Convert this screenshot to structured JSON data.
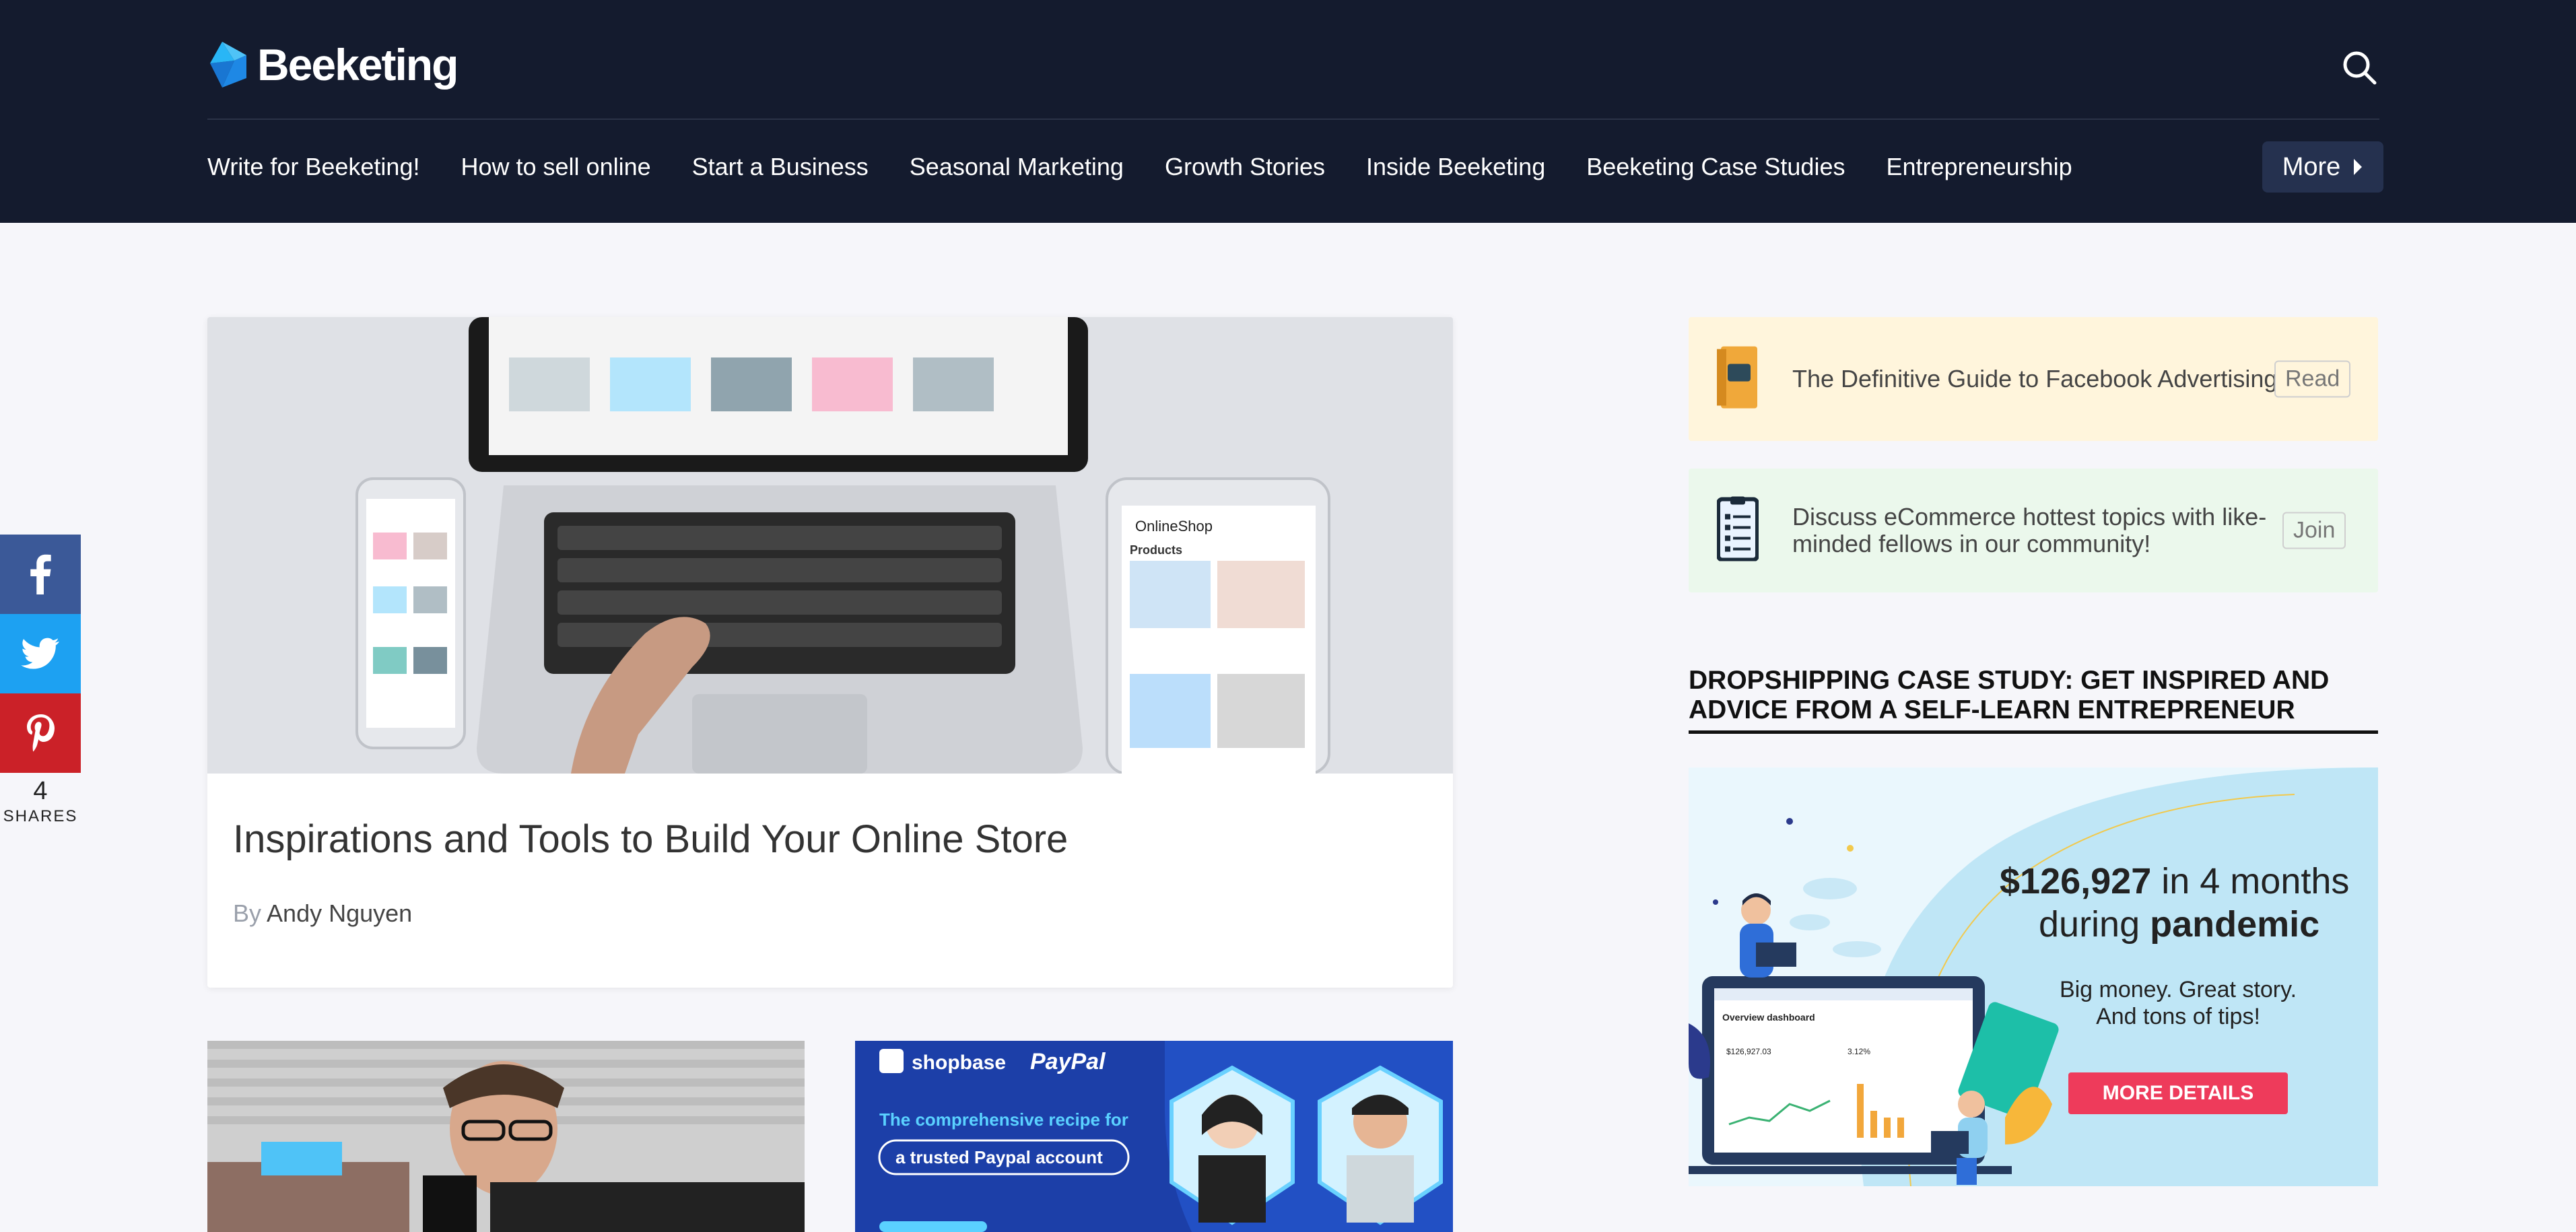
{
  "header": {
    "brand": "Beeketing",
    "nav_items": [
      "Write for Beeketing!",
      "How to sell online",
      "Start a Business",
      "Seasonal Marketing",
      "Growth Stories",
      "Inside Beeketing",
      "Beeketing Case Studies",
      "Entrepreneurship"
    ],
    "more_label": "More"
  },
  "share": {
    "count": "4",
    "label": "SHARES"
  },
  "featured": {
    "title": "Inspirations and Tools to Build Your Online Store",
    "by": "By",
    "author": "Andy Nguyen",
    "image_brand": "OnlineShop",
    "image_section": "Products"
  },
  "thumb2": {
    "brand1": "shopbase",
    "brand2": "PayPal",
    "line1": "The comprehensive recipe for",
    "line2": "a trusted Paypal account"
  },
  "sidebar": {
    "promo1": {
      "text": "The Definitive Guide to Facebook Advertising",
      "button": "Read"
    },
    "promo2": {
      "text": "Discuss eCommerce hottest topics with like-minded fellows in our community!",
      "button": "Join"
    },
    "heading": "DROPSHIPPING CASE STUDY: GET INSPIRED AND ADVICE FROM A SELF-LEARN ENTREPRENEUR",
    "banner": {
      "amount": "$126,927",
      "amount_suffix": " in 4 months",
      "during": "during ",
      "pandemic": "pandemic",
      "sub": "Big money. Great story. And tons of tips!",
      "cta": "MORE DETAILS",
      "dashboard_title": "Overview dashboard",
      "dashboard_value": "$126,927.03",
      "dashboard_pct": "3.12%"
    }
  },
  "colors": {
    "header_bg": "#141b2e",
    "more_bg": "#25314f",
    "facebook": "#3b5998",
    "twitter": "#1da1f2",
    "pinterest": "#cb2128",
    "cta": "#ee3b5b",
    "promo_yellow": "#fff5dc",
    "promo_green": "#ebf8ec"
  }
}
